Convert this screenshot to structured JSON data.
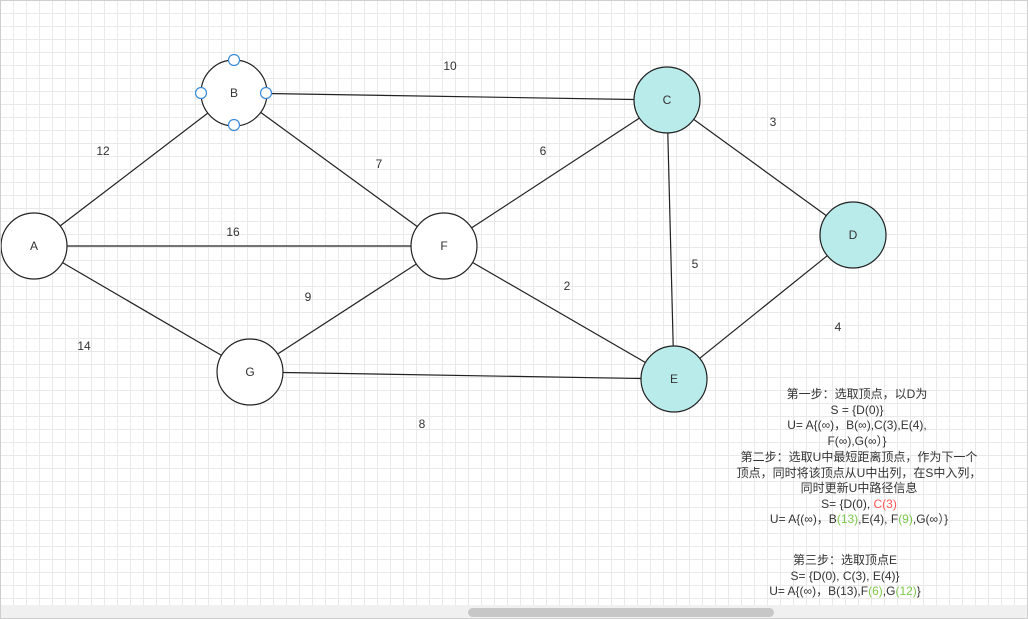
{
  "graph": {
    "nodes": [
      {
        "id": "A",
        "label": "A",
        "fill": "#ffffff"
      },
      {
        "id": "B",
        "label": "B",
        "fill": "#ffffff",
        "selected": true
      },
      {
        "id": "C",
        "label": "C",
        "fill": "#b9ebeb"
      },
      {
        "id": "D",
        "label": "D",
        "fill": "#b9ebeb"
      },
      {
        "id": "E",
        "label": "E",
        "fill": "#b9ebeb"
      },
      {
        "id": "F",
        "label": "F",
        "fill": "#ffffff"
      },
      {
        "id": "G",
        "label": "G",
        "fill": "#ffffff"
      }
    ],
    "edges": [
      {
        "from": "A",
        "to": "B",
        "weight": "12"
      },
      {
        "from": "B",
        "to": "C",
        "weight": "10"
      },
      {
        "from": "B",
        "to": "F",
        "weight": "7"
      },
      {
        "from": "A",
        "to": "F",
        "weight": "16"
      },
      {
        "from": "A",
        "to": "G",
        "weight": "14"
      },
      {
        "from": "F",
        "to": "C",
        "weight": "6"
      },
      {
        "from": "C",
        "to": "D",
        "weight": "3"
      },
      {
        "from": "C",
        "to": "E",
        "weight": "5"
      },
      {
        "from": "F",
        "to": "E",
        "weight": "2"
      },
      {
        "from": "G",
        "to": "F",
        "weight": "9"
      },
      {
        "from": "G",
        "to": "E",
        "weight": "8"
      },
      {
        "from": "D",
        "to": "E",
        "weight": "4"
      }
    ]
  },
  "notes": {
    "step1": {
      "line1": "第一步：选取顶点，以D为",
      "line2": "S = {D(0)}",
      "line3": "U= A{(∞)，B(∞),C(3),E(4),",
      "line4": "F(∞),G(∞）}"
    },
    "step2": {
      "line1": "第二步：选取U中最短距离顶点，作为下一个",
      "line2": "顶点，同时将该顶点从U中出列，在S中入列，",
      "line3": "同时更新U中路径信息",
      "line4_a": "S= {D(0), ",
      "line4_red": "C(3)",
      "line5_a": "U= A{(∞)，B",
      "line5_g1": "(13)",
      "line5_b": ",E(4), F",
      "line5_g2": "(9)",
      "line5_c": ",G(∞）}"
    },
    "step3": {
      "line1": "第三步：选取顶点E",
      "line2": "S= {D(0), C(3), E(4)}",
      "line3_a": "U= A{(∞)，B(13),F",
      "line3_g1": "(6)",
      "line3_b": ",G",
      "line3_g2": "(12)",
      "line3_c": "}"
    }
  },
  "colors": {
    "stroke": "#222222",
    "visited_fill": "#b9ebeb",
    "handle": "#3a8bd6",
    "highlight_red": "#ff5555",
    "highlight_green": "#7cc84a"
  }
}
